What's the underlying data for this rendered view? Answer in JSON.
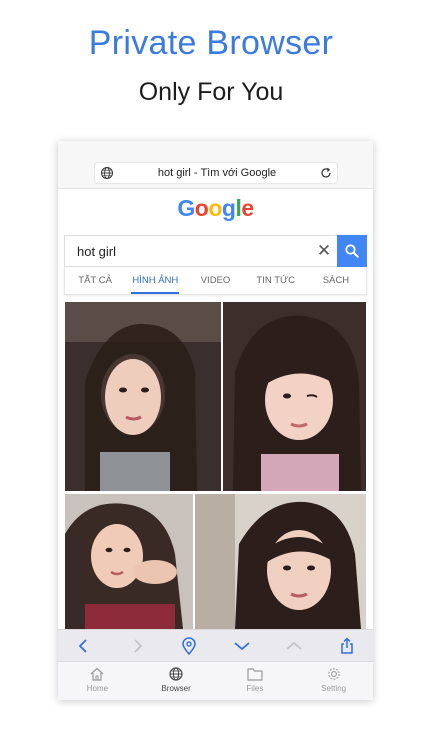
{
  "promo": {
    "title": "Private Browser",
    "subtitle": "Only For You"
  },
  "browser": {
    "url_title": "hot girl - Tìm với Google"
  },
  "google": {
    "logo_letters": [
      {
        "ch": "G",
        "color": "#4285f4"
      },
      {
        "ch": "o",
        "color": "#ea4335"
      },
      {
        "ch": "o",
        "color": "#fbbc05"
      },
      {
        "ch": "g",
        "color": "#4285f4"
      },
      {
        "ch": "l",
        "color": "#34a853"
      },
      {
        "ch": "e",
        "color": "#ea4335"
      }
    ],
    "query": "hot girl",
    "clear_symbol": "✕",
    "tabs": [
      "TẤT CẢ",
      "HÌNH ẢNH",
      "VIDEO",
      "TIN TỨC",
      "SÁCH"
    ],
    "active_tab": "HÌNH ẢNH"
  },
  "results": {
    "image_count": 4
  },
  "toolbar": {
    "back_icon": "chevron-left-icon",
    "forward_icon": "chevron-right-icon",
    "location_icon": "map-pin-icon",
    "scroll_down_icon": "chevron-down-icon",
    "scroll_up_icon": "chevron-up-icon",
    "share_icon": "share-icon"
  },
  "tabbar": {
    "items": [
      {
        "label": "Home",
        "icon": "home-icon"
      },
      {
        "label": "Browser",
        "icon": "globe-icon"
      },
      {
        "label": "Files",
        "icon": "folder-icon"
      },
      {
        "label": "Setting",
        "icon": "gear-icon"
      }
    ],
    "active": "Browser"
  },
  "colors": {
    "accent": "#3b7be0",
    "google_blue": "#4285f4",
    "tab_active": "#2f6fe0"
  }
}
